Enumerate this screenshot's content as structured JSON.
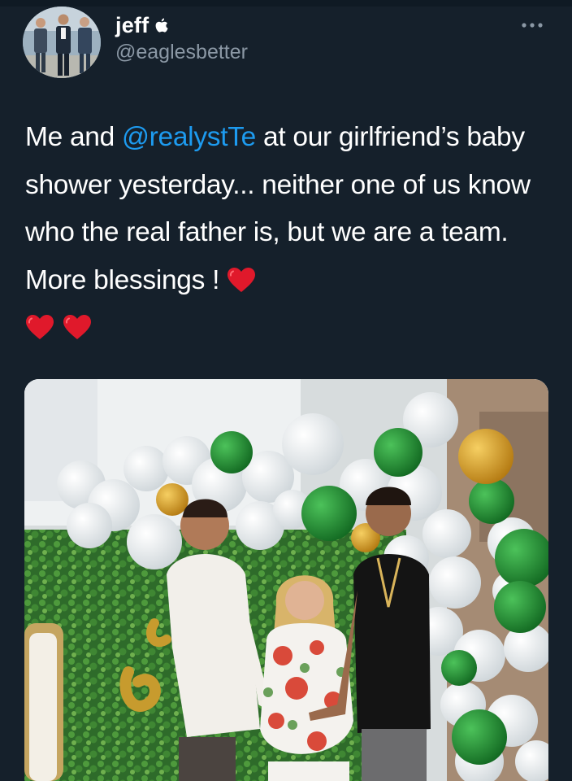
{
  "user": {
    "display_name": "jeff",
    "badge_icon": "apple-icon",
    "handle": "@eaglesbetter",
    "avatar_icon": "avatar-photo"
  },
  "tweet": {
    "text_before_mention": "Me and ",
    "mention": "@realystTe",
    "text_after_mention": " at our girlfriend’s baby shower yesterday... neither one of us know who the real father is, but we are a team. More blessings ! ",
    "emoji": [
      "red-heart",
      "red-heart",
      "red-heart"
    ]
  },
  "menu": {
    "icon": "more-dots-icon"
  },
  "media": {
    "type": "photo",
    "description_icon": "baby-shower-photo"
  },
  "colors": {
    "background": "#15202b",
    "text": "#ffffff",
    "secondary_text": "#8b98a5",
    "link": "#1d9bf0",
    "heart": "#e0192b",
    "balloon_green": "#1f8a2e",
    "balloon_gold": "#d9a126"
  }
}
